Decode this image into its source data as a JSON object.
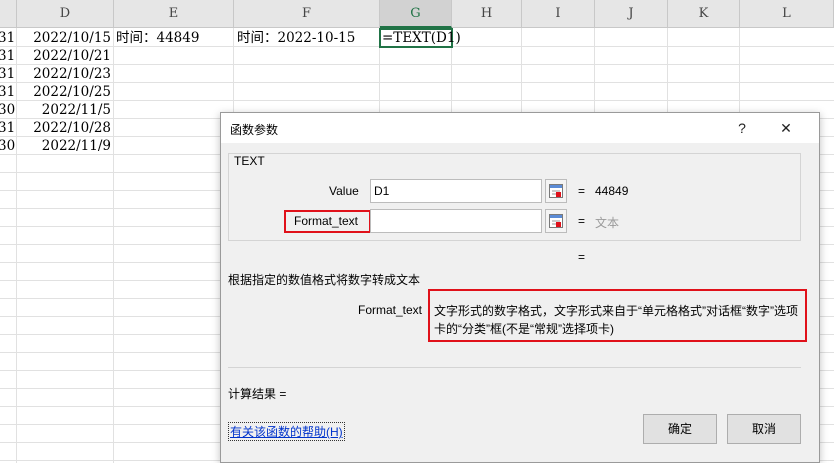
{
  "sheet": {
    "columns": [
      "D",
      "E",
      "F",
      "G",
      "H",
      "I",
      "J",
      "K",
      "L"
    ],
    "selected_column": "G",
    "col_a_values": [
      "31",
      "31",
      "31",
      "31",
      "30",
      "31",
      "30"
    ],
    "col_d_values": [
      "2022/10/15",
      "2022/10/21",
      "2022/10/23",
      "2022/10/25",
      "2022/11/5",
      "2022/10/28",
      "2022/11/9"
    ],
    "e1": "时间：44849",
    "f1": "时间：2022-10-15",
    "g1": "=TEXT(D1)"
  },
  "dialog": {
    "title": "函数参数",
    "help_glyph": "?",
    "close_glyph": "✕",
    "function_name": "TEXT",
    "args": [
      {
        "label": "Value",
        "value": "D1",
        "result": "44849"
      },
      {
        "label": "Format_text",
        "value": "",
        "result": "文本"
      }
    ],
    "eq": "=",
    "overall_eq": "=",
    "description": "根据指定的数值格式将数字转成文本",
    "detail_label": "Format_text",
    "detail_line1": "文字形式的数字格式，文字形式来自于“单元格格式”对话框“数字”选项",
    "detail_line2": "卡的“分类”框(不是“常规”选择项卡)",
    "calc_result": "计算结果 =",
    "help_link": "有关该函数的帮助(H)",
    "ok": "确定",
    "cancel": "取消"
  },
  "colors": {
    "accent": "#217346",
    "highlight": "#e0111a",
    "link": "#0033cc"
  }
}
